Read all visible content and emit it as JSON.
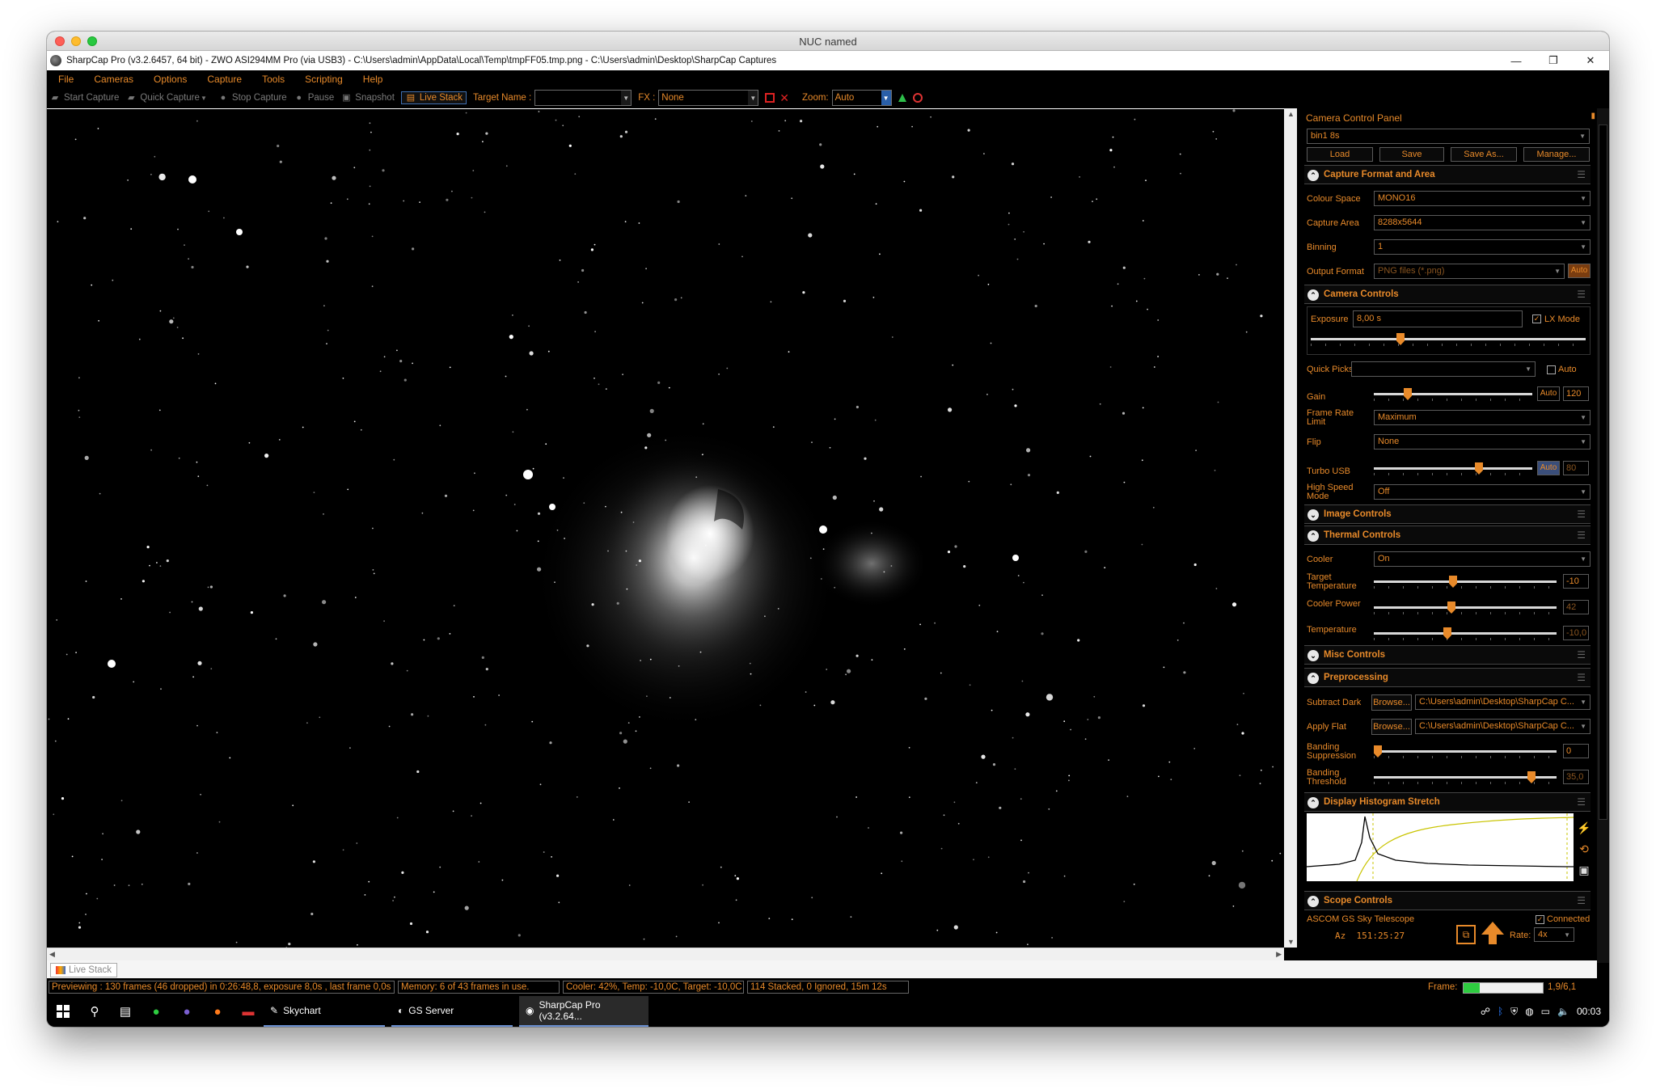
{
  "mac": {
    "title": "NUC named"
  },
  "window": {
    "title": "SharpCap Pro (v3.2.6457, 64 bit) - ZWO ASI294MM Pro (via USB3) - C:\\Users\\admin\\AppData\\Local\\Temp\\tmpFF05.tmp.png - C:\\Users\\admin\\Desktop\\SharpCap Captures",
    "minimize": "—",
    "restore": "❐",
    "close": "✕"
  },
  "menu": [
    "File",
    "Cameras",
    "Options",
    "Capture",
    "Tools",
    "Scripting",
    "Help"
  ],
  "toolbar": {
    "start_capture": "Start Capture",
    "quick_capture": "Quick Capture",
    "stop_capture": "Stop Capture",
    "pause": "Pause",
    "snapshot": "Snapshot",
    "live_stack": "Live Stack",
    "target_name_label": "Target Name :",
    "target_name_value": "",
    "fx_label": "FX :",
    "fx_value": "None",
    "zoom_label": "Zoom:",
    "zoom_value": "Auto"
  },
  "panel": {
    "title": "Camera Control Panel",
    "profile": "bin1 8s",
    "buttons": {
      "load": "Load",
      "save": "Save",
      "save_as": "Save As...",
      "manage": "Manage..."
    },
    "capture_format": {
      "title": "Capture Format and Area",
      "colour_space_label": "Colour Space",
      "colour_space": "MONO16",
      "capture_area_label": "Capture Area",
      "capture_area": "8288x5644",
      "binning_label": "Binning",
      "binning": "1",
      "output_format_label": "Output Format",
      "output_format": "PNG files (*.png)",
      "auto": "Auto"
    },
    "camera_controls": {
      "title": "Camera Controls",
      "exposure_label": "Exposure",
      "exposure": "8,00 s",
      "lx_mode": "LX Mode",
      "exposure_level": 0.32,
      "quick_picks_label": "Quick Picks",
      "quick_picks": "",
      "quick_auto": "Auto",
      "gain_label": "Gain",
      "gain_auto": "Auto",
      "gain": "120",
      "gain_level": 0.2,
      "frame_rate_label_1": "Frame Rate",
      "frame_rate_label_2": "Limit",
      "frame_rate": "Maximum",
      "flip_label": "Flip",
      "flip": "None",
      "turbo_label": "Turbo USB",
      "turbo_auto": "Auto",
      "turbo": "80",
      "turbo_level": 0.67,
      "hsm_label_1": "High Speed",
      "hsm_label_2": "Mode",
      "hsm": "Off"
    },
    "image_controls": {
      "title": "Image Controls"
    },
    "thermal": {
      "title": "Thermal Controls",
      "cooler_label": "Cooler",
      "cooler": "On",
      "target_label_1": "Target",
      "target_label_2": "Temperature",
      "target": "-10",
      "target_level": 0.43,
      "power_label": "Cooler Power",
      "power": "42",
      "power_level": 0.42,
      "temp_label": "Temperature",
      "temp": "-10,0",
      "temp_level": 0.4
    },
    "misc": {
      "title": "Misc Controls"
    },
    "preprocessing": {
      "title": "Preprocessing",
      "dark_label": "Subtract Dark",
      "browse": "Browse...",
      "dark": "C:\\Users\\admin\\Desktop\\SharpCap C...",
      "flat_label": "Apply Flat",
      "flat": "C:\\Users\\admin\\Desktop\\SharpCap C...",
      "banding_sup_label_1": "Banding",
      "banding_sup_label_2": "Suppression",
      "banding_sup": "0",
      "banding_sup_level": 0.0,
      "banding_thr_label_1": "Banding",
      "banding_thr_label_2": "Threshold",
      "banding_thr": "35,0",
      "banding_thr_level": 0.88
    },
    "histogram": {
      "title": "Display Histogram Stretch"
    },
    "scope": {
      "title": "Scope Controls",
      "telescope": "ASCOM GS Sky Telescope",
      "connected": "Connected",
      "az": "Az  151:25:27",
      "rate_label": "Rate:",
      "rate": "4x"
    }
  },
  "bottom_tab": "Live Stack",
  "status": {
    "preview": "Previewing : 130 frames (46 dropped) in 0:26:48,8, exposure 8,0s , last frame 0,0s",
    "memory": "Memory: 6 of 43 frames in use.",
    "cooler": "Cooler: 42%, Temp: -10,0C, Target: -10,0C",
    "stacked": "114 Stacked, 0 Ignored, 15m 12s",
    "frame_label": "Frame:",
    "frame_progress": 0.2,
    "frame_value": "1,9/6,1"
  },
  "taskbar": {
    "apps": [
      "Skychart",
      "GS Server",
      "SharpCap Pro (v3.2.64..."
    ],
    "clock": "00:03"
  }
}
